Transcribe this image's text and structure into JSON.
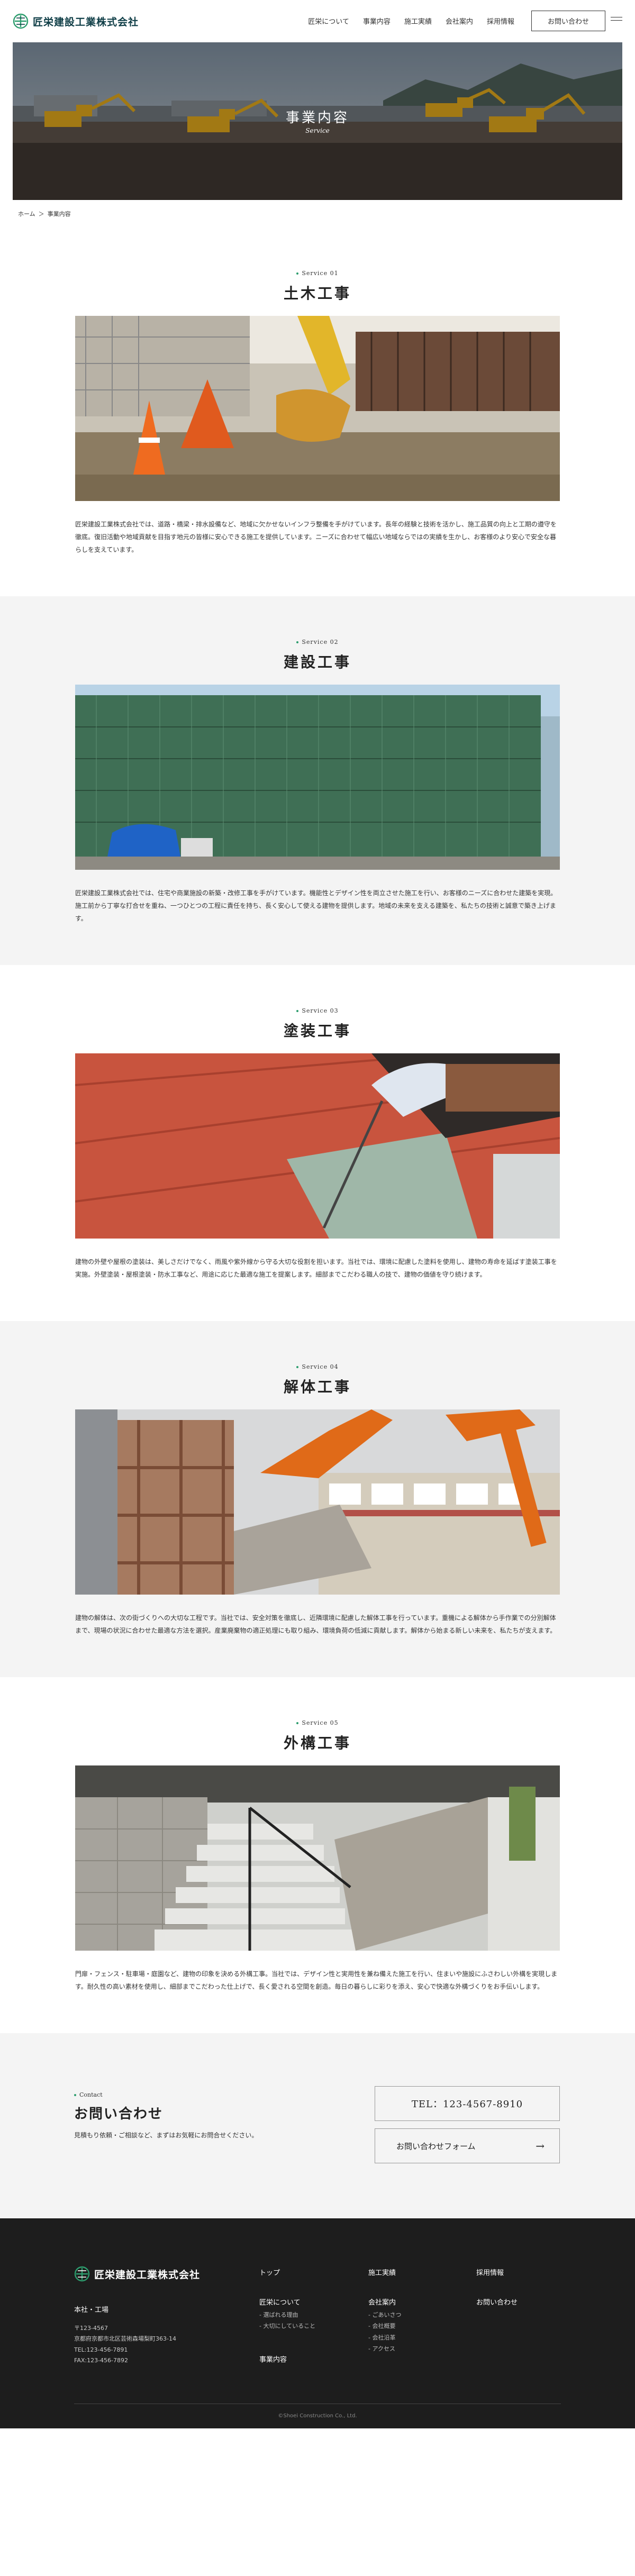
{
  "header": {
    "logo_text": "匠栄建設工業株式会社",
    "nav": [
      "匠栄について",
      "事業内容",
      "施工実績",
      "会社案内",
      "採用情報"
    ],
    "contact_button": "お問い合わせ"
  },
  "hero": {
    "title": "事業内容",
    "subtitle": "Service"
  },
  "breadcrumb": {
    "home": "ホーム",
    "separator": "＞",
    "current": "事業内容"
  },
  "services": [
    {
      "label": "Service 01",
      "title": "土木工事",
      "text": "匠栄建設工業株式会社では、道路・橋梁・排水設備など、地域に欠かせないインフラ整備を手がけています。長年の経験と技術を活かし、施工品質の向上と工期の遵守を徹底。復旧活動や地域貢献を目指す地元の皆様に安心できる施工を提供しています。ニーズに合わせて幅広い地域ならではの実績を生かし、お客様のより安心で安全な暮らしを支えています。"
    },
    {
      "label": "Service 02",
      "title": "建設工事",
      "text": "匠栄建設工業株式会社では、住宅や商業施設の新築・改修工事を手がけています。機能性とデザイン性を両立させた施工を行い、お客様のニーズに合わせた建築を実現。施工前から丁寧な打合せを重ね、一つひとつの工程に責任を持ち、長く安心して使える建物を提供します。地域の未来を支える建築を、私たちの技術と誠意で築き上げます。"
    },
    {
      "label": "Service 03",
      "title": "塗装工事",
      "text": "建物の外壁や屋根の塗装は、美しさだけでなく、雨風や紫外線から守る大切な役割を担います。当社では、環境に配慮した塗料を使用し、建物の寿命を延ばす塗装工事を実施。外壁塗装・屋根塗装・防水工事など、用途に応じた最適な施工を提案します。細部までこだわる職人の技で、建物の価値を守り続けます。"
    },
    {
      "label": "Service 04",
      "title": "解体工事",
      "text": "建物の解体は、次の街づくりへの大切な工程です。当社では、安全対策を徹底し、近隣環境に配慮した解体工事を行っています。重機による解体から手作業での分別解体まで、現場の状況に合わせた最適な方法を選択。産業廃棄物の適正処理にも取り組み、環境負荷の低減に貢献します。解体から始まる新しい未来を、私たちが支えます。"
    },
    {
      "label": "Service 05",
      "title": "外構工事",
      "text": "門扉・フェンス・駐車場・庭園など、建物の印象を決める外構工事。当社では、デザイン性と実用性を兼ね備えた施工を行い、住まいや施設にふさわしい外構を実現します。耐久性の高い素材を使用し、細部までこだわった仕上げで、長く愛される空間を創造。毎日の暮らしに彩りを添え、安心で快適な外構づくりをお手伝いします。"
    }
  ],
  "contact": {
    "label": "Contact",
    "title": "お問い合わせ",
    "description": "見積もり依頼・ご相談など、まずはお気軽にお問合せください。",
    "tel": "TEL：123-4567-8910",
    "form_button": "お問い合わせフォーム",
    "arrow": "→"
  },
  "footer": {
    "logo_text": "匠栄建設工業株式会社",
    "office_label": "本社・工場",
    "address_lines": [
      "〒123-4567",
      "京都府京都市北区芸術森場梨町363-14",
      "TEL:123-456-7891",
      "FAX:123-456-7892"
    ],
    "col1": {
      "top": "トップ",
      "about": "匠栄について",
      "about_items": [
        "- 選ばれる理由",
        "- 大切にしていること"
      ],
      "service": "事業内容"
    },
    "col2": {
      "works": "施工実績",
      "company": "会社案内",
      "company_items": [
        "- ごあいさつ",
        "- 会社概要",
        "- 会社沿革",
        "- アクセス"
      ]
    },
    "col3": {
      "recruit": "採用情報",
      "contact": "お問い合わせ"
    },
    "copyright": "©Shoei Construction Co., Ltd."
  },
  "colors": {
    "accent": "#2d9d6e",
    "logo": "#0e3d46",
    "footer_bg": "#1d1d1d",
    "section_gray": "#f4f4f4"
  },
  "icons": [
    "logo-mark-icon",
    "menu-icon",
    "arrow-right-icon"
  ]
}
